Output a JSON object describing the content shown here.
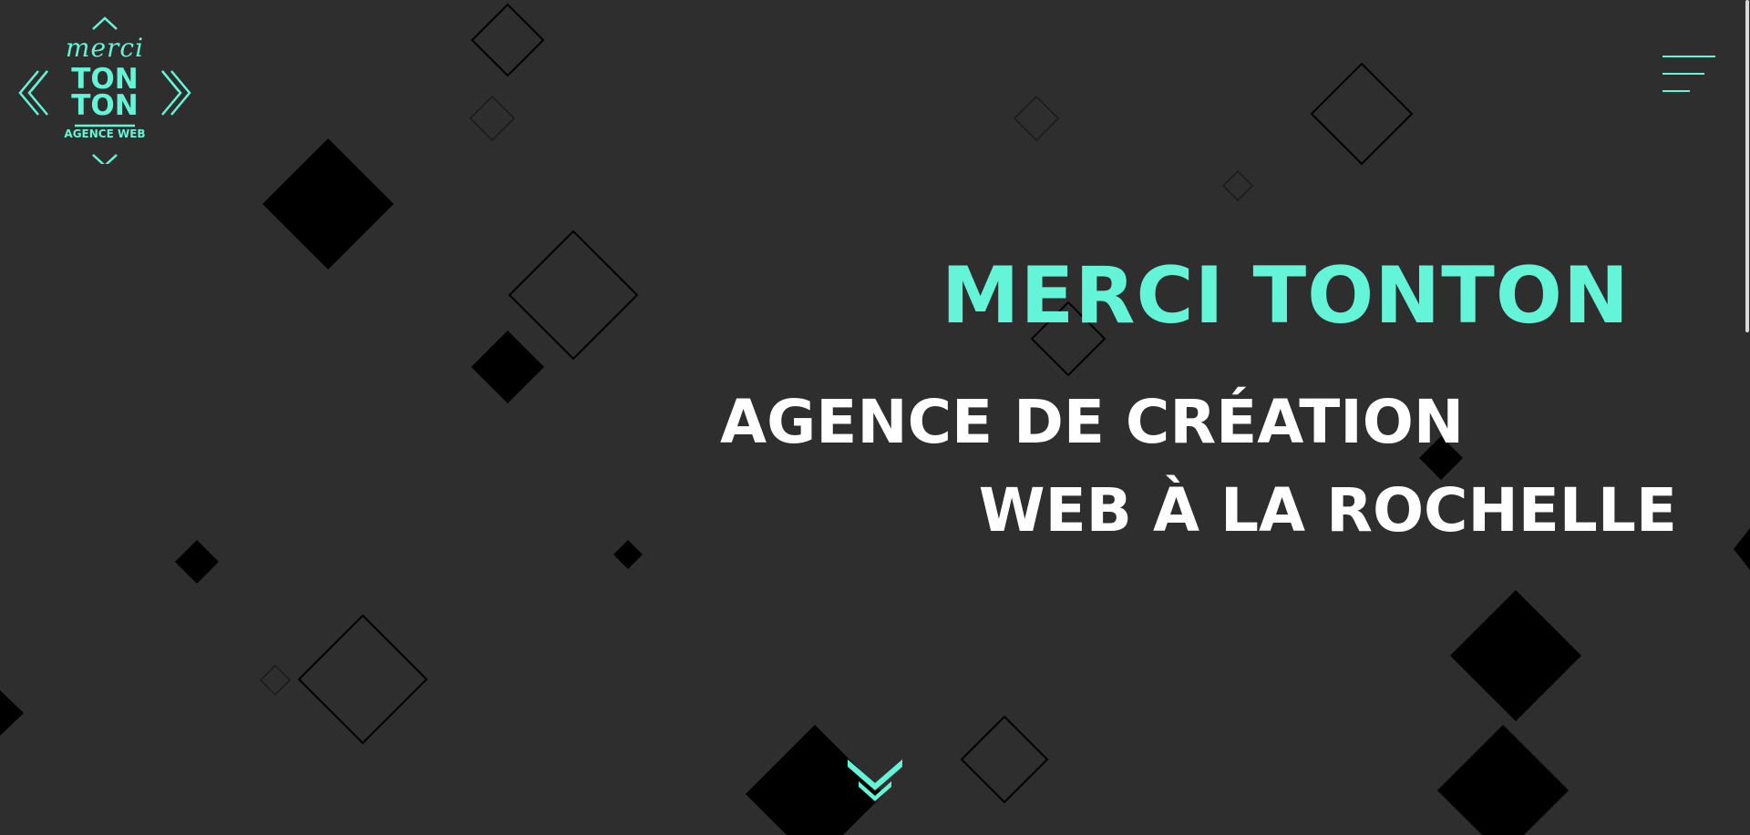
{
  "brand": {
    "logo_script": "merci",
    "logo_line1": "TON",
    "logo_line2": "TON",
    "logo_tagline": "AGENCE WEB",
    "accent_color": "#64f5d8",
    "background_color": "#2e2e2e"
  },
  "nav": {
    "menu_icon": "hamburger-menu-icon"
  },
  "hero": {
    "title": "MERCI TONTON",
    "subtitle_line1": "AGENCE DE CRÉATION",
    "subtitle_line2": "WEB À LA ROCHELLE"
  },
  "scroll": {
    "icon": "double-chevron-down-icon"
  }
}
